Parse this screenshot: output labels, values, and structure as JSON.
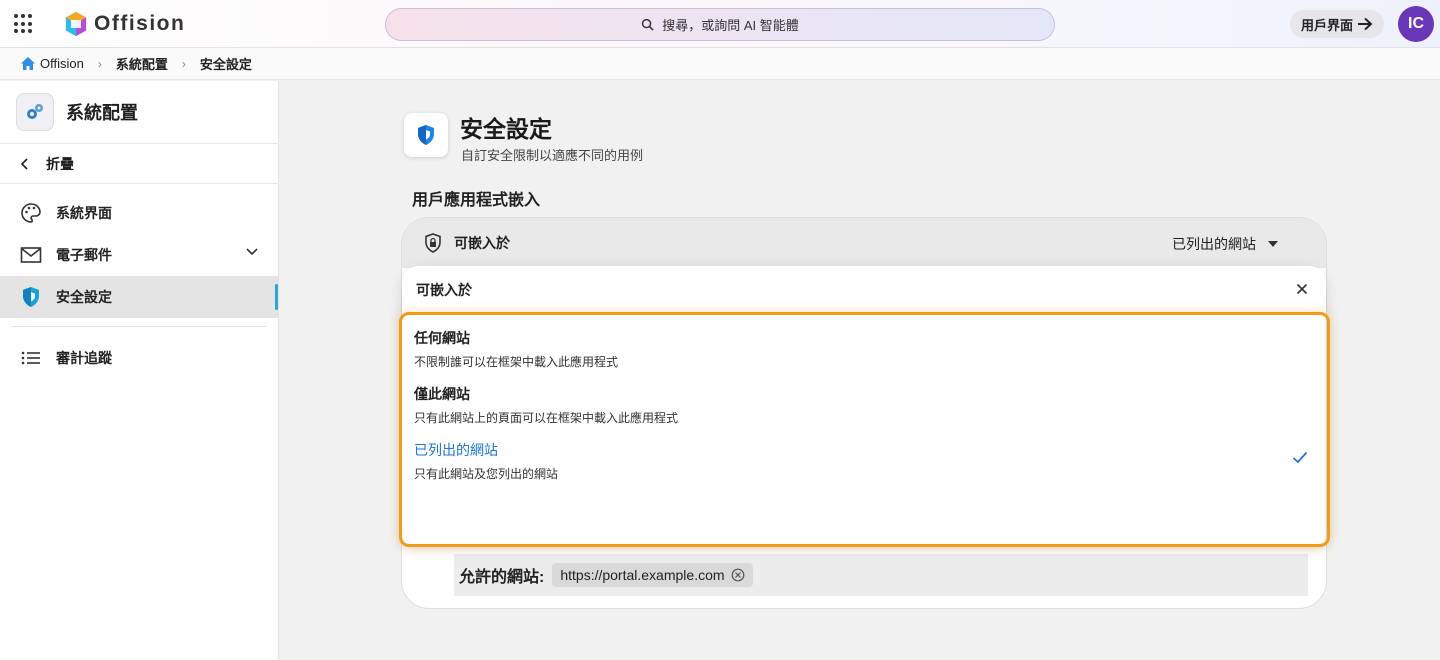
{
  "topbar": {
    "brand": "Offision",
    "search_placeholder": "搜尋，或詢問 AI 智能體",
    "user_button": "用戶界面",
    "avatar_initials": "IC"
  },
  "breadcrumb": [
    "Offision",
    "系統配置",
    "安全設定"
  ],
  "sidebar": {
    "title": "系統配置",
    "collapse": "折疊",
    "items": [
      {
        "label": "系統界面",
        "icon": "palette-icon"
      },
      {
        "label": "電子郵件",
        "icon": "mail-icon"
      },
      {
        "label": "安全設定",
        "icon": "shield-icon",
        "active": true
      },
      {
        "label": "審計追蹤",
        "icon": "list-icon"
      }
    ]
  },
  "page": {
    "title": "安全設定",
    "subtitle": "自訂安全限制以適應不同的用例",
    "section": "用戶應用程式嵌入"
  },
  "embed_card": {
    "label": "可嵌入於",
    "value": "已列出的網站",
    "allowed_label": "允許的網站:",
    "allowed_sites": [
      "https://portal.example.com"
    ]
  },
  "popup": {
    "title": "可嵌入於",
    "options": [
      {
        "title": "任何網站",
        "desc": "不限制誰可以在框架中載入此應用程式"
      },
      {
        "title": "僅此網站",
        "desc": "只有此網站上的頁面可以在框架中載入此應用程式"
      },
      {
        "title": "已列出的網站",
        "desc": "只有此網站及您列出的網站",
        "selected": true
      }
    ]
  },
  "colors": {
    "accent": "#2aa7d6",
    "selected_text": "#1d73d6",
    "highlight": "#f29a1a",
    "avatar": "#6a37b8"
  }
}
